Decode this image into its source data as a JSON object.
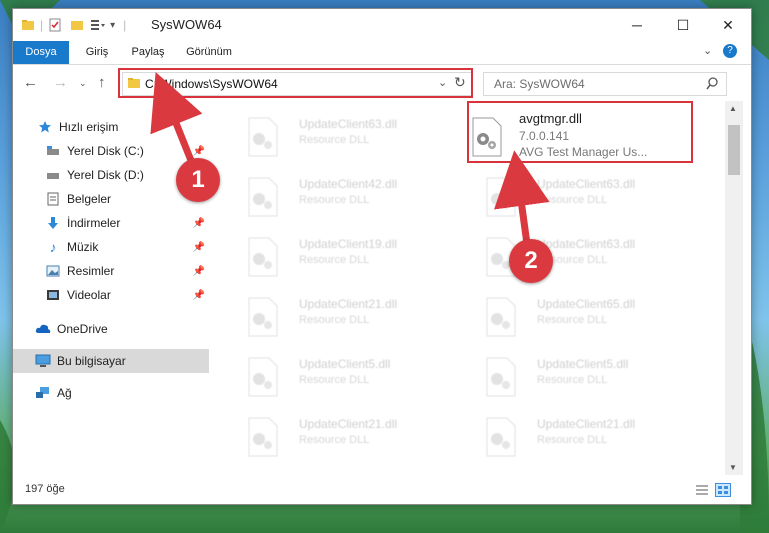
{
  "titlebar": {
    "title": "SysWOW64",
    "minimize": "─",
    "maximize": "☐",
    "close": "✕"
  },
  "ribbon": {
    "tabs": [
      "Dosya",
      "Giriş",
      "Paylaş",
      "Görünüm"
    ],
    "help": "?"
  },
  "address": {
    "path": "C:\\Windows\\SysWOW64",
    "search_placeholder": "Ara: SysWOW64"
  },
  "nav": {
    "items": [
      {
        "label": "Hızlı erişim",
        "icon": "star-icon"
      },
      {
        "label": "Yerel Disk (C:)",
        "icon": "drive-icon"
      },
      {
        "label": "Yerel Disk (D:)",
        "icon": "drive-icon"
      },
      {
        "label": "Belgeler",
        "icon": "documents-icon"
      },
      {
        "label": "İndirmeler",
        "icon": "download-icon"
      },
      {
        "label": "Müzik",
        "icon": "music-icon"
      },
      {
        "label": "Resimler",
        "icon": "pictures-icon"
      },
      {
        "label": "Videolar",
        "icon": "video-icon"
      },
      {
        "label": "OneDrive",
        "icon": "cloud-icon"
      },
      {
        "label": "Bu bilgisayar",
        "icon": "computer-icon"
      },
      {
        "label": "Ağ",
        "icon": "network-icon"
      }
    ]
  },
  "files": {
    "highlighted": {
      "name": "avgtmgr.dll",
      "version": "7.0.0.141",
      "description": "AVG Test Manager Us..."
    },
    "left": [
      {
        "name": "UpdateClient63.dll",
        "desc": "Resource DLL"
      },
      {
        "name": "UpdateClient42.dll",
        "desc": "Resource DLL"
      },
      {
        "name": "UpdateClient19.dll",
        "desc": "Resource DLL"
      },
      {
        "name": "UpdateClient21.dll",
        "desc": "Resource DLL"
      },
      {
        "name": "UpdateClient5.dll",
        "desc": "Resource DLL"
      },
      {
        "name": "UpdateClient21.dll",
        "desc": "Resource DLL"
      }
    ],
    "right": [
      {
        "name": "UpdateClient63.dll",
        "desc": "Resource DLL"
      },
      {
        "name": "UpdateClient63.dll",
        "desc": "Resource DLL"
      },
      {
        "name": "UpdateClient65.dll",
        "desc": "Resource DLL"
      },
      {
        "name": "UpdateClient5.dll",
        "desc": "Resource DLL"
      },
      {
        "name": "UpdateClient21.dll",
        "desc": "Resource DLL"
      }
    ]
  },
  "status": {
    "count": "197 öğe"
  },
  "annotations": {
    "step1": "1",
    "step2": "2",
    "color": "#d9393f"
  }
}
